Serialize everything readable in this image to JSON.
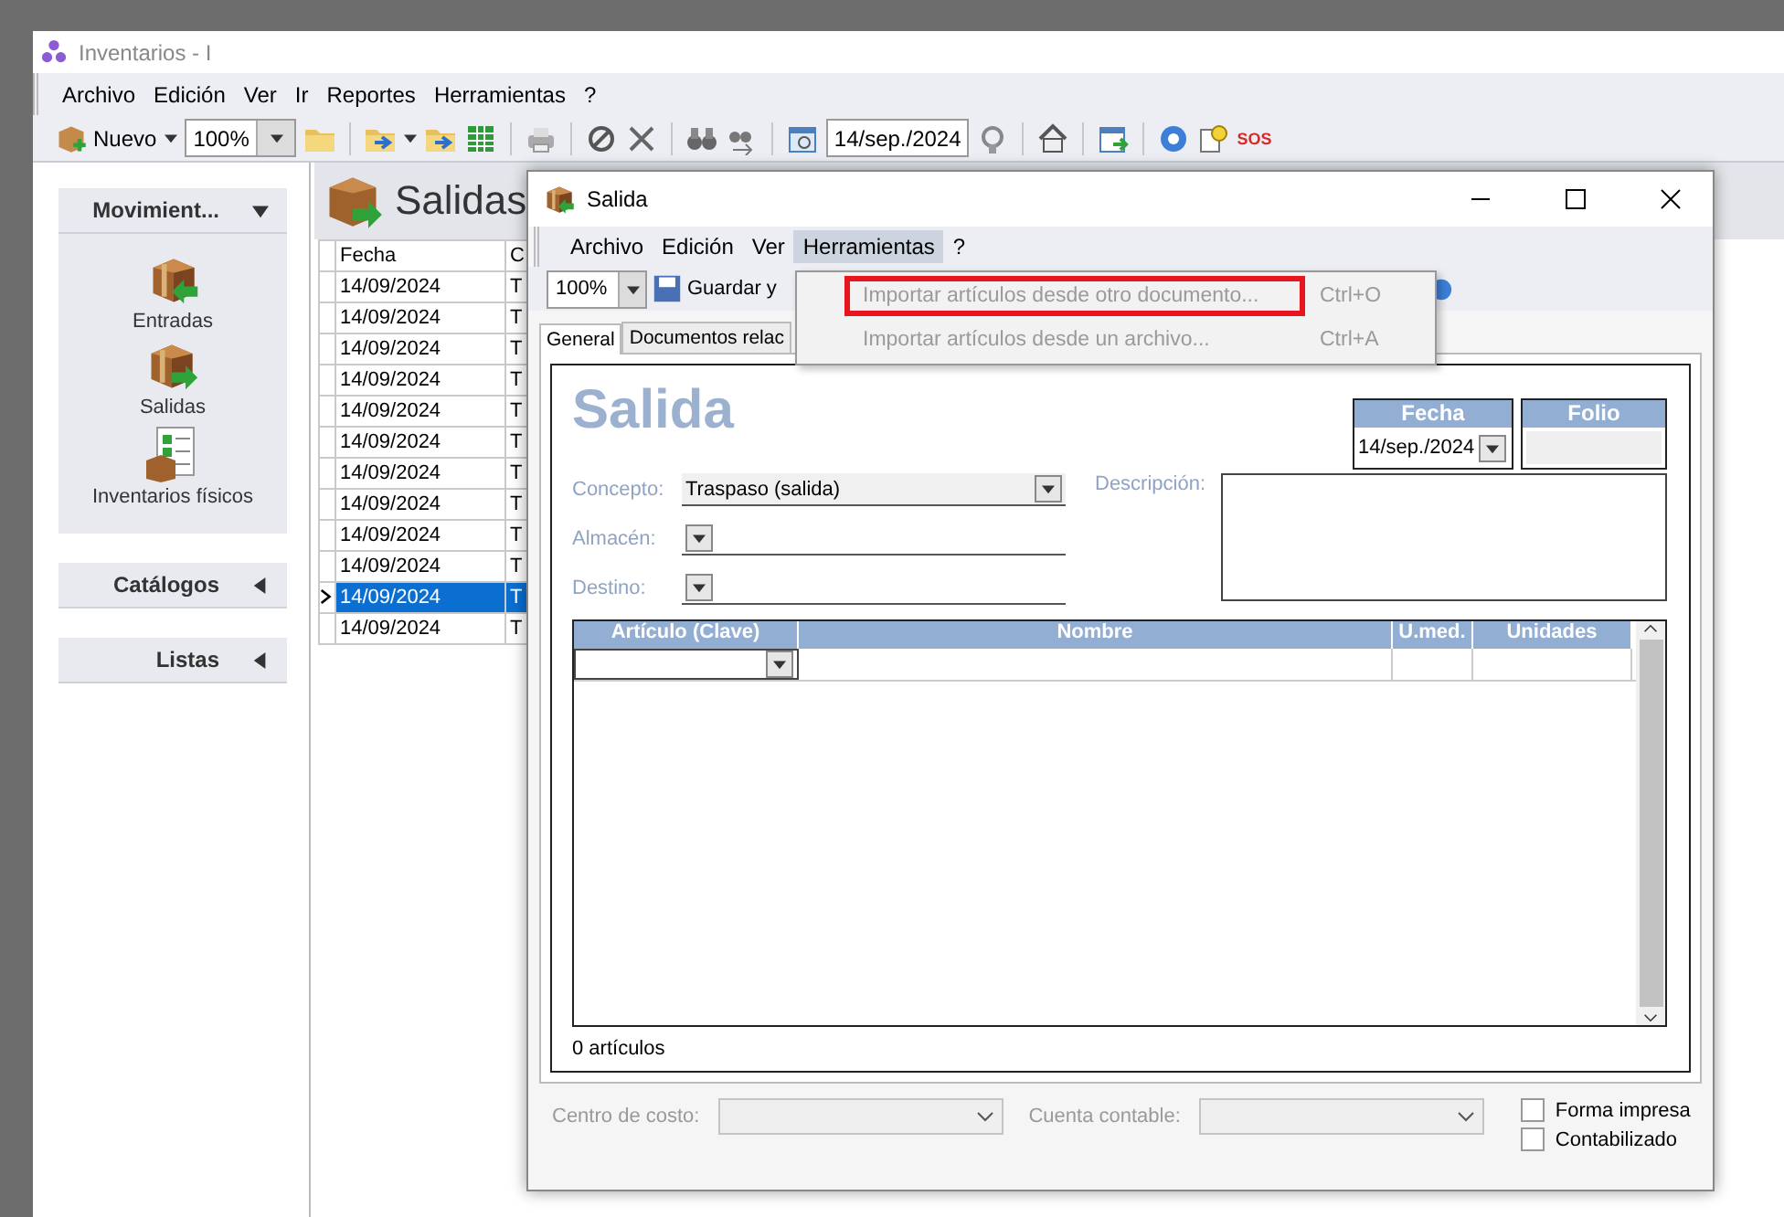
{
  "window": {
    "title": "Inventarios - I"
  },
  "menu": [
    "Archivo",
    "Edición",
    "Ver",
    "Ir",
    "Reportes",
    "Herramientas",
    "?"
  ],
  "toolbar": {
    "new_label": "Nuevo",
    "zoom": "100%",
    "date": "14/sep./2024",
    "sos": "SOS"
  },
  "sidebar": {
    "groups": [
      {
        "title": "Movimient...",
        "expanded": true,
        "items": [
          {
            "label": "Entradas",
            "kind": "in"
          },
          {
            "label": "Salidas",
            "kind": "out"
          },
          {
            "label": "Inventarios físicos",
            "kind": "count"
          }
        ]
      },
      {
        "title": "Catálogos",
        "expanded": false
      },
      {
        "title": "Listas",
        "expanded": false
      }
    ]
  },
  "page": {
    "title": "Salidas"
  },
  "list": {
    "columns": [
      "Fecha",
      "C"
    ],
    "rows": [
      {
        "cells": [
          "14/09/2024",
          "T"
        ],
        "selected": false
      },
      {
        "cells": [
          "14/09/2024",
          "T"
        ],
        "selected": false
      },
      {
        "cells": [
          "14/09/2024",
          "T"
        ],
        "selected": false
      },
      {
        "cells": [
          "14/09/2024",
          "T"
        ],
        "selected": false
      },
      {
        "cells": [
          "14/09/2024",
          "T"
        ],
        "selected": false
      },
      {
        "cells": [
          "14/09/2024",
          "T"
        ],
        "selected": false
      },
      {
        "cells": [
          "14/09/2024",
          "T"
        ],
        "selected": false
      },
      {
        "cells": [
          "14/09/2024",
          "T"
        ],
        "selected": false
      },
      {
        "cells": [
          "14/09/2024",
          "T"
        ],
        "selected": false
      },
      {
        "cells": [
          "14/09/2024",
          "T"
        ],
        "selected": false
      },
      {
        "cells": [
          "14/09/2024",
          "T"
        ],
        "selected": true
      },
      {
        "cells": [
          "14/09/2024",
          "T"
        ],
        "selected": false
      }
    ]
  },
  "dialog": {
    "title": "Salida",
    "menu": [
      {
        "label": "Archivo",
        "open": false
      },
      {
        "label": "Edición",
        "open": false
      },
      {
        "label": "Ver",
        "open": false
      },
      {
        "label": "Herramientas",
        "open": true
      },
      {
        "label": "?",
        "open": false
      }
    ],
    "toolbar": {
      "zoom": "100%",
      "save_label": "Guardar y"
    },
    "dropdown": [
      {
        "label": "Importar artículos desde otro documento...",
        "shortcut": "Ctrl+O",
        "highlighted": true,
        "disabled": true
      },
      {
        "label": "Importar artículos desde un archivo...",
        "shortcut": "Ctrl+A",
        "highlighted": false,
        "disabled": true
      }
    ],
    "tabs": [
      {
        "label": "General",
        "selected": true
      },
      {
        "label": "Documentos relac",
        "selected": false
      }
    ],
    "form": {
      "heading": "Salida",
      "fecha_label": "Fecha",
      "fecha": "14/sep./2024",
      "folio_label": "Folio",
      "fields": [
        {
          "label": "Concepto:",
          "value": "Traspaso (salida)"
        },
        {
          "label": "Almacén:"
        },
        {
          "label": "Destino:"
        }
      ],
      "description_label": "Descripción:",
      "grid": {
        "columns": [
          "Artículo (Clave)",
          "Nombre",
          "U.med.",
          "Unidades"
        ]
      },
      "count": "0 artículos"
    },
    "footer": {
      "cost_center_label": "Centro de costo:",
      "account_label": "Cuenta contable:",
      "checks": [
        {
          "label": "Forma impresa",
          "checked": false
        },
        {
          "label": "Contabilizado",
          "checked": false
        }
      ]
    }
  }
}
